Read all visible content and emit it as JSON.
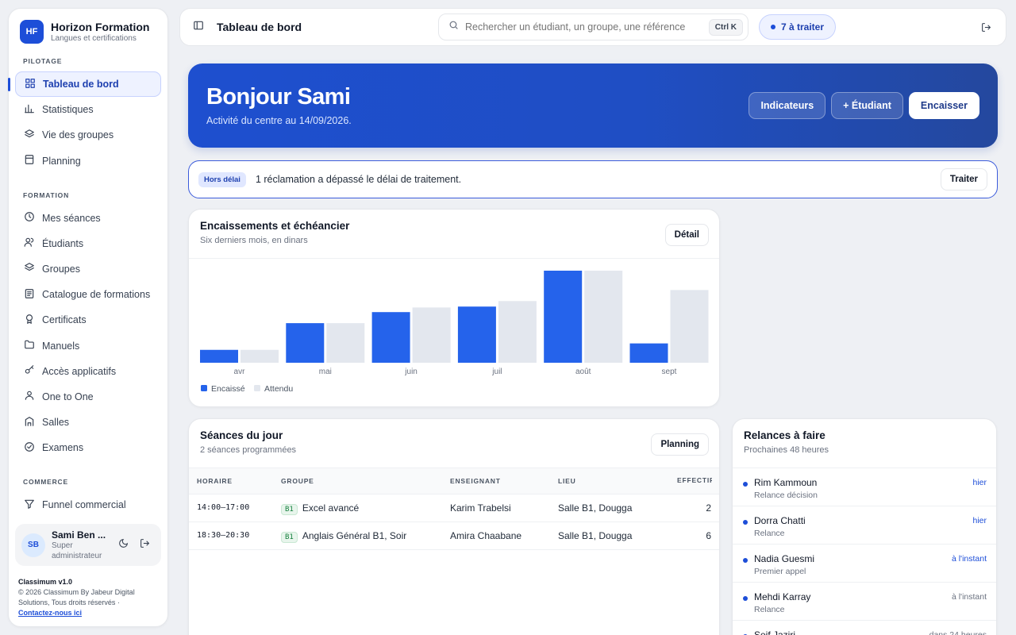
{
  "brand": {
    "initials": "HF",
    "name": "Horizon Formation",
    "subtitle": "Langues et certifications"
  },
  "nav": [
    {
      "section": "PILOTAGE",
      "items": [
        {
          "label": "Tableau de bord",
          "icon": "dashboard-icon",
          "active": true
        },
        {
          "label": "Statistiques",
          "icon": "bar-chart-icon"
        },
        {
          "label": "Vie des groupes",
          "icon": "layers-icon"
        },
        {
          "label": "Planning",
          "icon": "calendar-icon"
        }
      ]
    },
    {
      "section": "FORMATION",
      "items": [
        {
          "label": "Mes séances",
          "icon": "clock-icon"
        },
        {
          "label": "Étudiants",
          "icon": "users-icon"
        },
        {
          "label": "Groupes",
          "icon": "layers-icon"
        },
        {
          "label": "Catalogue de formations",
          "icon": "book-icon"
        },
        {
          "label": "Certificats",
          "icon": "award-icon"
        },
        {
          "label": "Manuels",
          "icon": "folder-icon"
        },
        {
          "label": "Accès applicatifs",
          "icon": "key-icon"
        },
        {
          "label": "One to One",
          "icon": "user-icon"
        },
        {
          "label": "Salles",
          "icon": "building-icon"
        },
        {
          "label": "Examens",
          "icon": "exam-icon"
        }
      ]
    },
    {
      "section": "COMMERCE",
      "items": [
        {
          "label": "Funnel commercial",
          "icon": "funnel-icon"
        }
      ]
    }
  ],
  "user": {
    "initials": "SB",
    "name": "Sami Ben ...",
    "role": "Super administrateur"
  },
  "footer": {
    "version": "Classimum v1.0",
    "copyright": "© 2026 Classimum By Jabeur Digital Solutions, Tous droits réservés ·",
    "contact": "Contactez-nous ici"
  },
  "topbar": {
    "title": "Tableau de bord",
    "search_placeholder": "Rechercher un étudiant, un groupe, une référence",
    "shortcut": "Ctrl K",
    "todo": "7 à traiter"
  },
  "hero": {
    "greeting": "Bonjour Sami",
    "subtitle": "Activité du centre au 14/09/2026.",
    "buttons": {
      "indicators": "Indicateurs",
      "add_student": "+ Étudiant",
      "collect": "Encaisser"
    }
  },
  "alert": {
    "badge": "Hors délai",
    "message": "1 réclamation a dépassé le délai de traitement.",
    "action": "Traiter"
  },
  "chart_card": {
    "title": "Encaissements et échéancier",
    "subtitle": "Six derniers mois, en dinars",
    "action": "Détail"
  },
  "chart_data": {
    "type": "bar",
    "categories": [
      "avr",
      "mai",
      "juin",
      "juil",
      "août",
      "sept"
    ],
    "series": [
      {
        "name": "Encaissé",
        "color": "#2563eb",
        "values": [
          14,
          43,
          55,
          61,
          100,
          21
        ]
      },
      {
        "name": "Attendu",
        "color": "#e3e7ee",
        "values": [
          14,
          43,
          60,
          67,
          100,
          79
        ]
      }
    ],
    "ylim": [
      0,
      100
    ],
    "legend": "bottom-left",
    "grid": false
  },
  "seances": {
    "title": "Séances du jour",
    "subtitle": "2 séances programmées",
    "action": "Planning",
    "columns": [
      "HORAIRE",
      "GROUPE",
      "ENSEIGNANT",
      "LIEU",
      "EFFECTIF"
    ],
    "rows": [
      {
        "time": "14:00–17:00",
        "level": "B1",
        "group": "Excel avancé",
        "teacher": "Karim Trabelsi",
        "place": "Salle B1, Dougga",
        "count": "2"
      },
      {
        "time": "18:30–20:30",
        "level": "B1",
        "group": "Anglais Général B1, Soir",
        "teacher": "Amira Chaabane",
        "place": "Salle B1, Dougga",
        "count": "6"
      }
    ]
  },
  "relances": {
    "title": "Relances à faire",
    "subtitle": "Prochaines 48 heures",
    "items": [
      {
        "name": "Rim Kammoun",
        "type": "Relance décision",
        "when": "hier",
        "accent": true
      },
      {
        "name": "Dorra Chatti",
        "type": "Relance",
        "when": "hier",
        "accent": true
      },
      {
        "name": "Nadia Guesmi",
        "type": "Premier appel",
        "when": "à l'instant",
        "accent": true
      },
      {
        "name": "Mehdi Karray",
        "type": "Relance",
        "when": "à l'instant",
        "accent": false
      },
      {
        "name": "Seif Jaziri",
        "type": "",
        "when": "dans 24 heures",
        "accent": false
      }
    ]
  },
  "colors": {
    "accent": "#1d4ed8",
    "hero": "#1e4fcf"
  }
}
